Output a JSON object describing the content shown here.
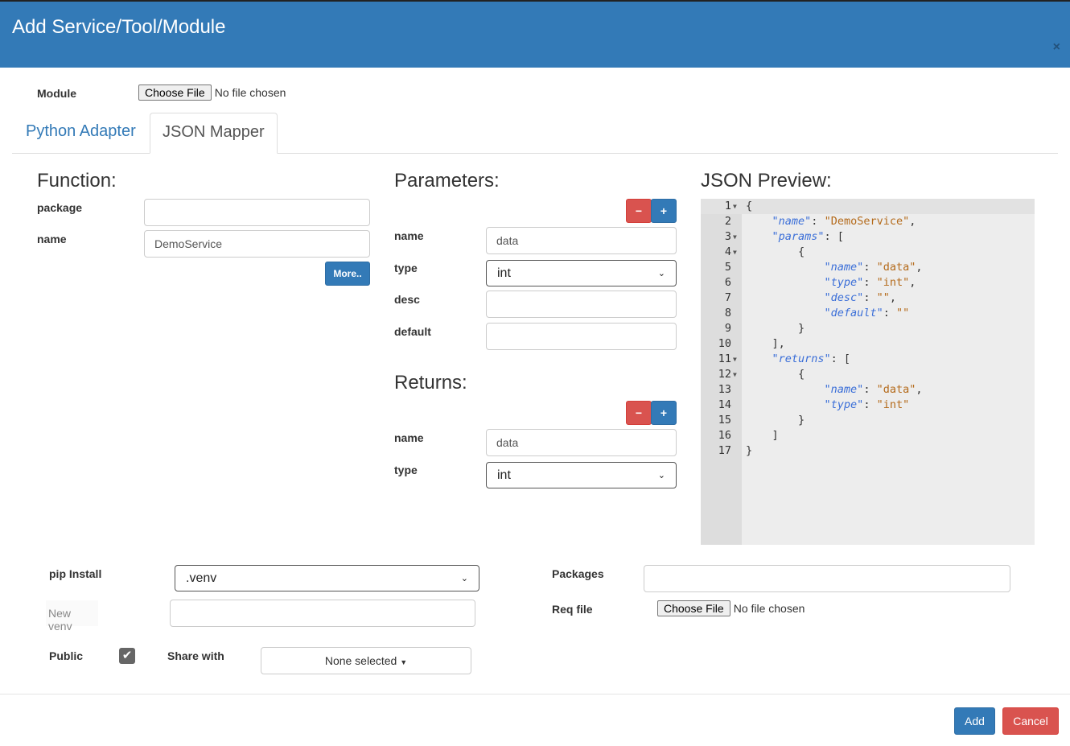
{
  "header": {
    "title": "Add Service/Tool/Module",
    "close": "×"
  },
  "module": {
    "label": "Module",
    "choose": "Choose File",
    "status": "No file chosen"
  },
  "tabs": [
    {
      "label": "Python Adapter",
      "active": false
    },
    {
      "label": "JSON Mapper",
      "active": true
    }
  ],
  "function": {
    "heading": "Function:",
    "package_label": "package",
    "package_value": "",
    "name_label": "name",
    "name_value": "DemoService",
    "more": "More.."
  },
  "parameters": {
    "heading": "Parameters:",
    "name_label": "name",
    "name_value": "data",
    "type_label": "type",
    "type_value": "int",
    "desc_label": "desc",
    "desc_value": "",
    "default_label": "default",
    "default_value": ""
  },
  "returns": {
    "heading": "Returns:",
    "name_label": "name",
    "name_value": "data",
    "type_label": "type",
    "type_value": "int"
  },
  "buttons": {
    "minus": "−",
    "plus": "+"
  },
  "preview": {
    "heading": "JSON Preview:",
    "fold_lines": [
      1,
      3,
      4,
      11,
      12
    ],
    "lines": [
      "{",
      "    \"name\": \"DemoService\",",
      "    \"params\": [",
      "        {",
      "            \"name\": \"data\",",
      "            \"type\": \"int\",",
      "            \"desc\": \"\",",
      "            \"default\": \"\"",
      "        }",
      "    ],",
      "    \"returns\": [",
      "        {",
      "            \"name\": \"data\",",
      "            \"type\": \"int\"",
      "        }",
      "    ]",
      "}"
    ]
  },
  "bottom": {
    "pip_label": "pip Install",
    "pip_value": ".venv",
    "newvenv_label": "New venv",
    "newvenv_value": "",
    "packages_label": "Packages",
    "packages_value": "",
    "req_label": "Req file",
    "req_choose": "Choose File",
    "req_status": "No file chosen",
    "public_label": "Public",
    "public_checked": true,
    "share_label": "Share with",
    "share_value": "None selected"
  },
  "footer": {
    "add": "Add",
    "cancel": "Cancel"
  },
  "colors": {
    "primary": "#337ab7",
    "danger": "#d9534f"
  }
}
